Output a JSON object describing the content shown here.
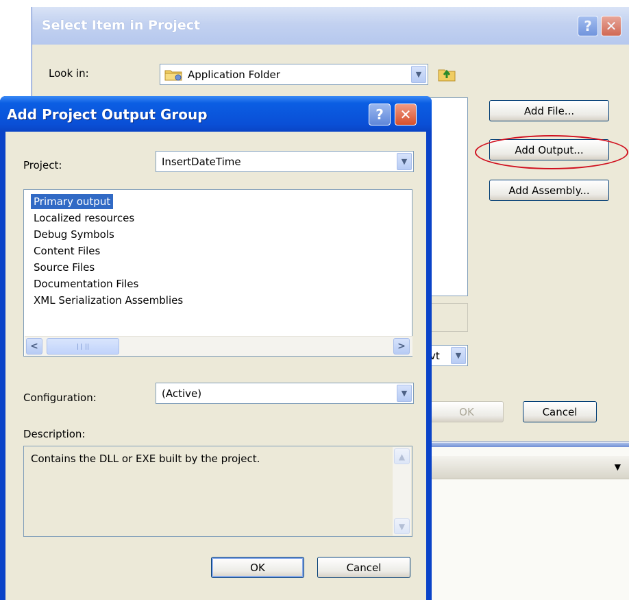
{
  "back_dialog": {
    "title": "Select Item in Project",
    "look_in_label": "Look in:",
    "look_in_value": "Application Folder",
    "buttons": {
      "add_file": "Add File...",
      "add_output": "Add Output...",
      "add_assembly": "Add Assembly...",
      "ok": "OK",
      "cancel": "Cancel"
    },
    "partial_combo_text": "vt"
  },
  "front_dialog": {
    "title": "Add Project Output Group",
    "project_label": "Project:",
    "project_value": "InsertDateTime",
    "output_items": [
      "Primary output",
      "Localized resources",
      "Debug Symbols",
      "Content Files",
      "Source Files",
      "Documentation Files",
      "XML Serialization Assemblies"
    ],
    "selected_item": "Primary output",
    "configuration_label": "Configuration:",
    "configuration_value": "(Active)",
    "description_label": "Description:",
    "description_text": "Contains the DLL or EXE built by the project.",
    "ok_label": "OK",
    "cancel_label": "Cancel"
  },
  "titlebar": {
    "help_glyph": "?",
    "close_glyph": "✕"
  },
  "colors": {
    "front_titlebar": "#0a4fd6",
    "back_titlebar": "#c2d1f0",
    "dialog_face": "#ece9d8",
    "selection": "#316ac5",
    "highlight_ellipse": "#d0101f"
  }
}
